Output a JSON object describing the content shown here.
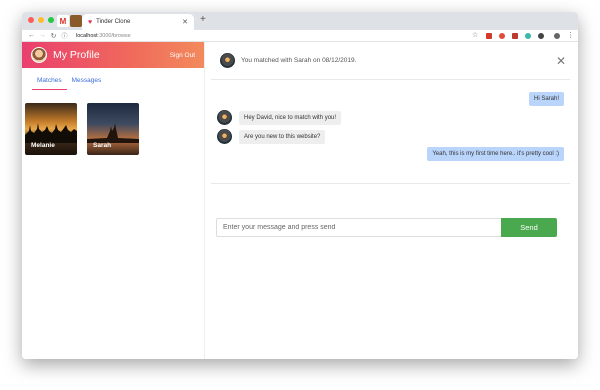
{
  "browser": {
    "tab_title": "Tinder Clone",
    "tab_close": "✕",
    "new_tab": "+",
    "url_host": "localhost",
    "url_path": ":3000/browse",
    "colors": {
      "chrome": "#dee1e6",
      "light_red": "#ff5f57",
      "light_yellow": "#febc2e",
      "light_green": "#28c840"
    }
  },
  "sidebar": {
    "title": "My Profile",
    "sign_out": "Sign Out",
    "tabs": [
      {
        "label": "Matches",
        "active": true
      },
      {
        "label": "Messages",
        "active": false
      }
    ],
    "matches": [
      {
        "name": "Melanie"
      },
      {
        "name": "Sarah"
      }
    ],
    "colors": {
      "header_start": "#e93f6e",
      "header_end": "#f28a5c",
      "tab_text": "#3b6ed8"
    }
  },
  "chat": {
    "match_text": "You matched with Sarah on 08/12/2019.",
    "close_icon": "✕",
    "messages": [
      {
        "text": "Hi Sarah!",
        "direction": "out"
      },
      {
        "text": "Hey David, nice to match with you!",
        "direction": "in"
      },
      {
        "text": "Are you new to this website?",
        "direction": "in"
      },
      {
        "text": "Yeah, this is my first time here.. it's pretty cool :)",
        "direction": "out"
      }
    ],
    "input_placeholder": "Enter your message and press send",
    "send_label": "Send",
    "colors": {
      "outgoing": "#b9d5fb",
      "incoming": "#eeeeee",
      "send": "#4aa84e"
    }
  }
}
